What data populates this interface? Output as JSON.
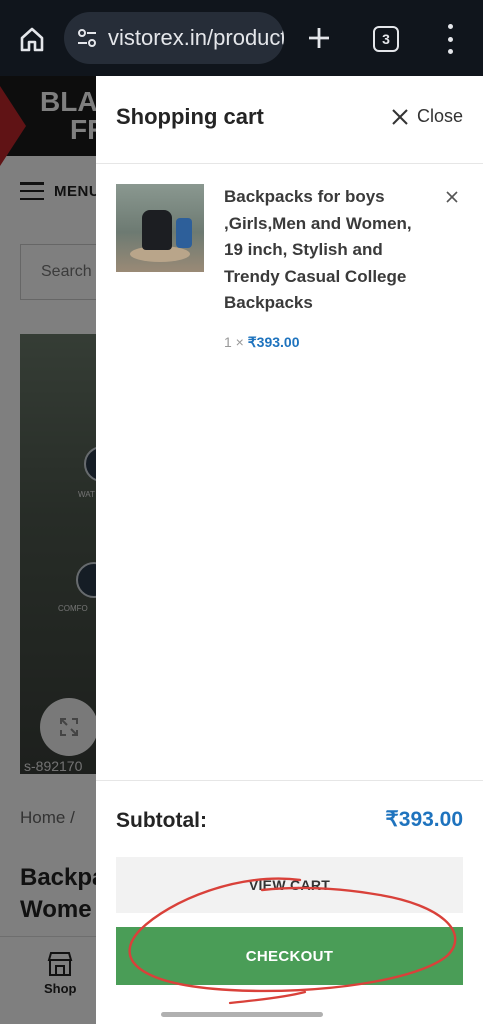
{
  "browser": {
    "url": "vistorex.in/product",
    "tab_count": "3",
    "icons": [
      "home-icon",
      "site-settings-icon",
      "plus-icon",
      "tab-switcher-icon",
      "more-vert-icon"
    ]
  },
  "background_page": {
    "banner_text_line1": "BLA",
    "banner_text_line2": "FR",
    "menu_label": "MENU",
    "search_placeholder": "Search",
    "image_badge_1": "WAT",
    "image_badge_2": "COMFO",
    "sku_text": "s-892170",
    "breadcrumb": "Home  /",
    "title_line1": "Backpa",
    "title_line2": "Wome",
    "bottom_nav_shop": "Shop"
  },
  "cart": {
    "title": "Shopping cart",
    "close_label": "Close",
    "items": [
      {
        "name": "Backpacks for boys ,Girls,Men and Women, 19 inch, Stylish and Trendy Casual College Backpacks",
        "quantity_text": "1 ×",
        "price": "₹393.00"
      }
    ],
    "subtotal_label": "Subtotal:",
    "subtotal_value": "₹393.00",
    "view_cart_label": "VIEW CART",
    "checkout_label": "CHECKOUT"
  },
  "colors": {
    "accent_price": "#1e73be",
    "checkout_green": "#4a9d57",
    "annotation_red": "#d9413a"
  }
}
